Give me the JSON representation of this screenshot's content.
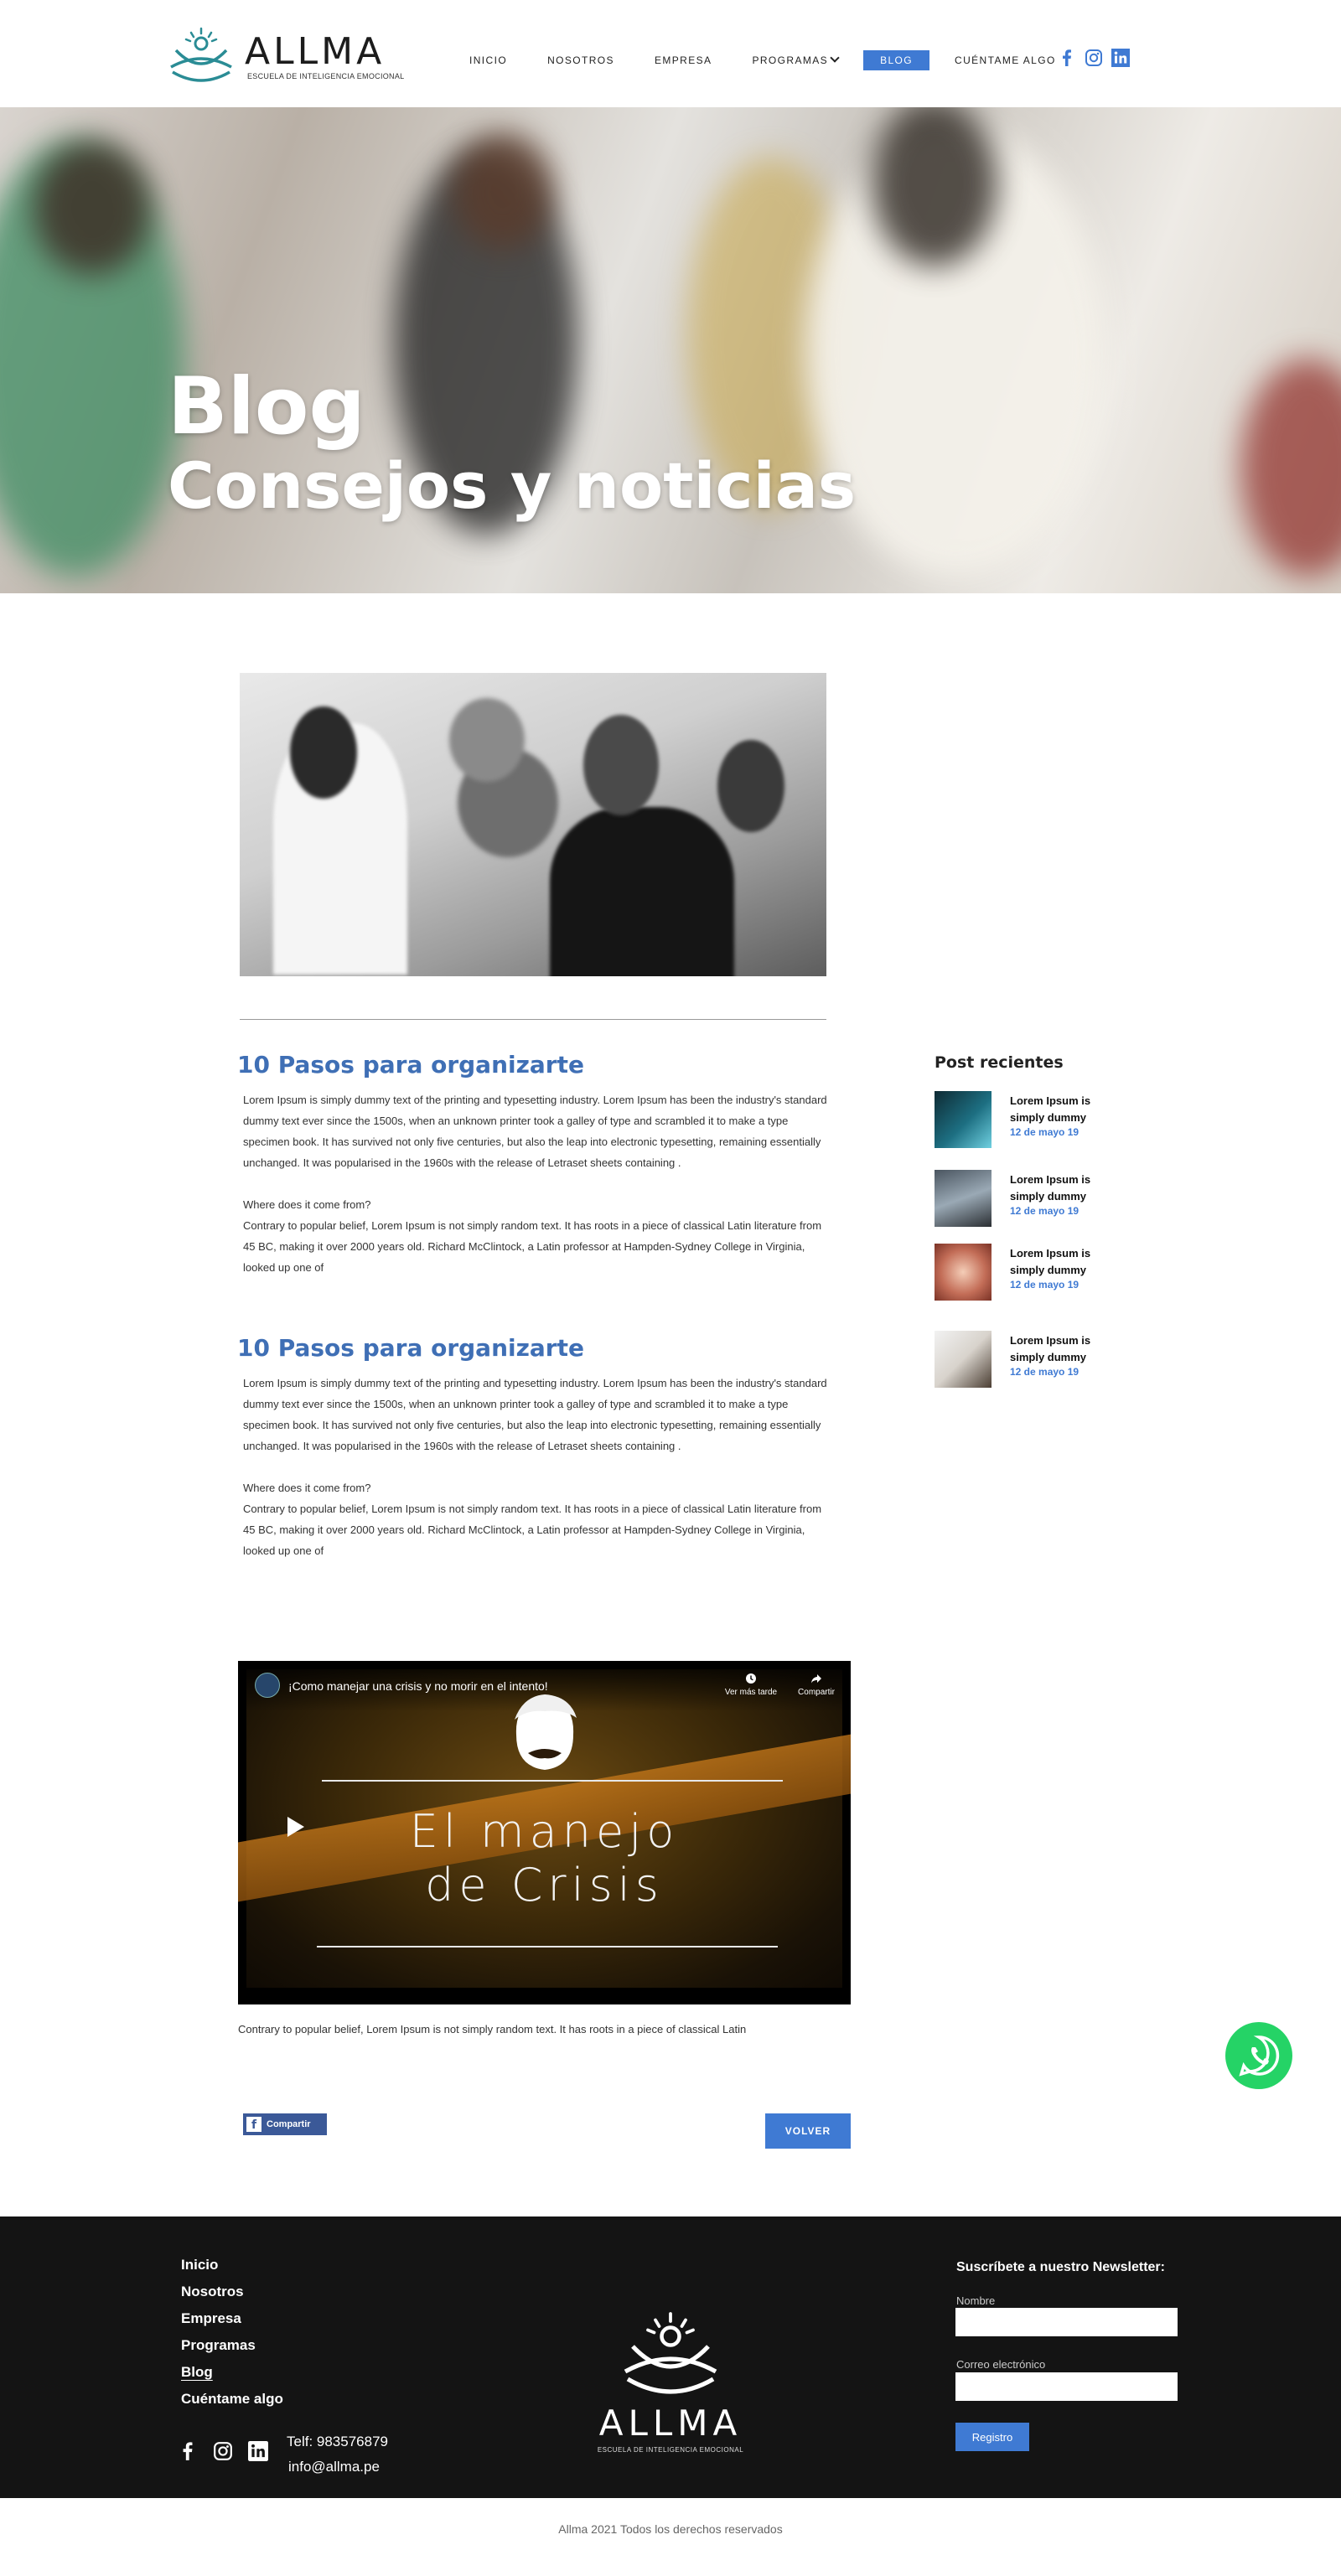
{
  "header": {
    "logo_word": "ALLMA",
    "logo_tagline": "ESCUELA DE INTELIGENCIA EMOCIONAL",
    "nav": [
      {
        "label": "INICIO"
      },
      {
        "label": "NOSOTROS"
      },
      {
        "label": "EMPRESA"
      },
      {
        "label": "PROGRAMAS"
      },
      {
        "label": "BLOG"
      },
      {
        "label": "CUÉNTAME ALGO"
      }
    ],
    "active_nav": "BLOG",
    "social_icons": [
      "facebook-icon",
      "instagram-icon",
      "linkedin-icon"
    ]
  },
  "hero": {
    "title": "Blog",
    "subtitle": "Consejos y noticias"
  },
  "posts": [
    {
      "title": "10 Pasos para organizarte",
      "p1": "Lorem Ipsum is simply dummy text of the printing and typesetting industry. Lorem Ipsum has been the industry's standard dummy text ever since the 1500s, when an unknown printer took a galley of type and scrambled it to make a type specimen book. It has survived not only five centuries, but also the leap into electronic typesetting, remaining essentially unchanged. It was popularised in the 1960s with the release of Letraset sheets containing .",
      "p2_heading": "Where does it come from?",
      "p2": "Contrary to popular belief, Lorem Ipsum is not simply random text. It has roots in a piece of classical Latin literature from 45 BC, making it over 2000 years old. Richard McClintock, a Latin professor at Hampden-Sydney College in Virginia, looked up one of"
    },
    {
      "title": "10 Pasos para organizarte",
      "p1": "Lorem Ipsum is simply dummy text of the printing and typesetting industry. Lorem Ipsum has been the industry's standard dummy text ever since the 1500s, when an unknown printer took a galley of type and scrambled it to make a type specimen book. It has survived not only five centuries, but also the leap into electronic typesetting, remaining essentially unchanged. It was popularised in the 1960s with the release of Letraset sheets containing .",
      "p2_heading": "Where does it come from?",
      "p2": "Contrary to popular belief, Lorem Ipsum is not simply random text. It has roots in a piece of classical Latin literature from 45 BC, making it over 2000 years old. Richard McClintock, a Latin professor at Hampden-Sydney College in Virginia, looked up one of"
    }
  ],
  "video": {
    "title": "¡Como manejar una crisis y no morir en el intento!",
    "watch_later": "Ver más tarde",
    "share": "Compartir",
    "headline_1": "El manejo",
    "headline_2": "de Crisis",
    "caption": "Contrary to popular belief, Lorem Ipsum is not simply random text. It has roots in a piece of classical Latin"
  },
  "actions": {
    "share_label": "Compartir",
    "back_label": "VOLVER"
  },
  "sidebar": {
    "title": "Post recientes",
    "items": [
      {
        "text": "Lorem Ipsum is simply dummy",
        "date": "12 de mayo 19"
      },
      {
        "text": "Lorem Ipsum is simply dummy",
        "date": "12 de mayo 19"
      },
      {
        "text": "Lorem Ipsum is simply dummy",
        "date": "12 de mayo 19"
      },
      {
        "text": "Lorem Ipsum is simply dummy",
        "date": "12 de mayo 19"
      }
    ]
  },
  "footer": {
    "links": [
      "Inicio",
      "Nosotros",
      "Empresa",
      "Programas",
      "Blog",
      "Cuéntame algo"
    ],
    "current_link": "Blog",
    "phone": "Telf: 983576879",
    "email": "info@allma.pe",
    "logo_word": "ALLMA",
    "logo_tagline": "ESCUELA DE INTELIGENCIA EMOCIONAL",
    "newsletter_title": "Suscríbete a nuestro Newsletter:",
    "name_label": "Nombre",
    "email_label": "Correo electrónico",
    "submit_label": "Registro"
  },
  "copyright": "Allma 2021 Todos los derechos reservados",
  "colors": {
    "accent": "#3f7ad3",
    "heading_blue": "#3f6fb5",
    "footer_bg": "#141414",
    "whatsapp": "#25d366"
  }
}
